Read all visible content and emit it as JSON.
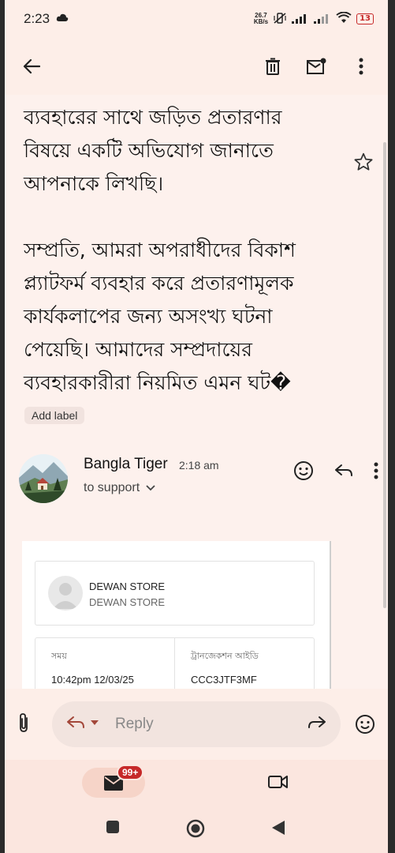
{
  "status_bar": {
    "time": "2:23",
    "net_speed_value": "26.7",
    "net_speed_unit": "KB/s",
    "battery": "13"
  },
  "toolbar": {
    "back_icon": "arrow-left-icon",
    "delete_icon": "trash-icon",
    "mark_unread_icon": "mail-unread-icon",
    "more_icon": "more-vert-icon"
  },
  "message": {
    "paragraphs": [
      [
        "ব্যবহারের সাথে জড়িত প্রতারণার",
        "বিষয়ে একটি অভিযোগ জানাতে",
        "আপনাকে লিখছি।"
      ],
      [
        "সম্প্রতি, আমরা অপরাধীদের বিকাশ",
        "প্ল্যাটফর্ম ব্যবহার করে প্রতারণামূলক",
        "কার্যকলাপের জন্য অসংখ্য ঘটনা",
        "পেয়েছি। আমাদের সম্প্রদায়ের",
        "ব্যবহারকারীরা নিয়মিত এমন ঘট�"
      ]
    ],
    "add_label": "Add label"
  },
  "sender": {
    "name": "Bangla Tiger",
    "time": "2:18 am",
    "recipients": "to support"
  },
  "receipt": {
    "store_name": "DEWAN STORE",
    "store_sub": "DEWAN STORE",
    "time_label": "সময়",
    "time_value": "10:42pm 12/03/25",
    "txn_label": "ট্রানজেকশন আইডি",
    "txn_value": "CCC3JTF3MF"
  },
  "reply_bar": {
    "reply_label": "Reply"
  },
  "bottom_nav": {
    "mail_badge": "99+"
  },
  "colors": {
    "background": "#fdeee8",
    "badge": "#c62828"
  }
}
